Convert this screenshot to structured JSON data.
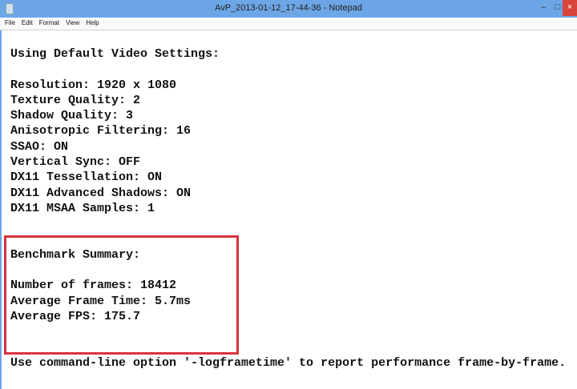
{
  "window": {
    "title": "AvP_2013-01-12_17-44-36 - Notepad",
    "minimize": "–",
    "maximize": "□",
    "close": "×"
  },
  "menu": [
    "File",
    "Edit",
    "Format",
    "View",
    "Help"
  ],
  "text": {
    "header": "Using Default Video Settings:",
    "settings": [
      "Resolution: 1920 x 1080",
      "Texture Quality: 2",
      "Shadow Quality: 3",
      "Anisotropic Filtering: 16",
      "SSAO: ON",
      "Vertical Sync: OFF",
      "DX11 Tessellation: ON",
      "DX11 Advanced Shadows: ON",
      "DX11 MSAA Samples: 1"
    ],
    "summary_title": "Benchmark Summary:",
    "summary": [
      "Number of frames: 18412",
      "Average Frame Time: 5.7ms",
      "Average FPS: 175.7"
    ],
    "footer": "Use command-line option '-logframetime' to report performance frame-by-frame."
  },
  "colors": {
    "highlight": "#d8343f",
    "titlebar": "#6da6e6"
  }
}
